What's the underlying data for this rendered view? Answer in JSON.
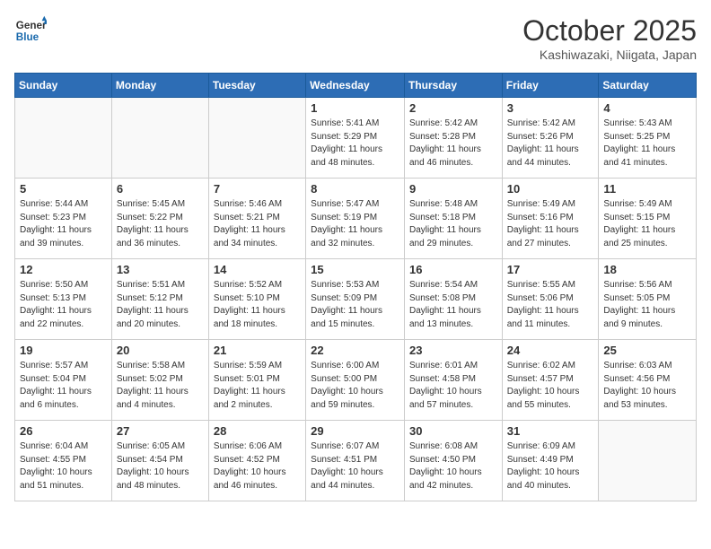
{
  "logo": {
    "line1": "General",
    "line2": "Blue"
  },
  "title": "October 2025",
  "location": "Kashiwazaki, Niigata, Japan",
  "weekdays": [
    "Sunday",
    "Monday",
    "Tuesday",
    "Wednesday",
    "Thursday",
    "Friday",
    "Saturday"
  ],
  "weeks": [
    [
      {
        "day": "",
        "sunrise": "",
        "sunset": "",
        "daylight": ""
      },
      {
        "day": "",
        "sunrise": "",
        "sunset": "",
        "daylight": ""
      },
      {
        "day": "",
        "sunrise": "",
        "sunset": "",
        "daylight": ""
      },
      {
        "day": "1",
        "sunrise": "Sunrise: 5:41 AM",
        "sunset": "Sunset: 5:29 PM",
        "daylight": "Daylight: 11 hours and 48 minutes."
      },
      {
        "day": "2",
        "sunrise": "Sunrise: 5:42 AM",
        "sunset": "Sunset: 5:28 PM",
        "daylight": "Daylight: 11 hours and 46 minutes."
      },
      {
        "day": "3",
        "sunrise": "Sunrise: 5:42 AM",
        "sunset": "Sunset: 5:26 PM",
        "daylight": "Daylight: 11 hours and 44 minutes."
      },
      {
        "day": "4",
        "sunrise": "Sunrise: 5:43 AM",
        "sunset": "Sunset: 5:25 PM",
        "daylight": "Daylight: 11 hours and 41 minutes."
      }
    ],
    [
      {
        "day": "5",
        "sunrise": "Sunrise: 5:44 AM",
        "sunset": "Sunset: 5:23 PM",
        "daylight": "Daylight: 11 hours and 39 minutes."
      },
      {
        "day": "6",
        "sunrise": "Sunrise: 5:45 AM",
        "sunset": "Sunset: 5:22 PM",
        "daylight": "Daylight: 11 hours and 36 minutes."
      },
      {
        "day": "7",
        "sunrise": "Sunrise: 5:46 AM",
        "sunset": "Sunset: 5:21 PM",
        "daylight": "Daylight: 11 hours and 34 minutes."
      },
      {
        "day": "8",
        "sunrise": "Sunrise: 5:47 AM",
        "sunset": "Sunset: 5:19 PM",
        "daylight": "Daylight: 11 hours and 32 minutes."
      },
      {
        "day": "9",
        "sunrise": "Sunrise: 5:48 AM",
        "sunset": "Sunset: 5:18 PM",
        "daylight": "Daylight: 11 hours and 29 minutes."
      },
      {
        "day": "10",
        "sunrise": "Sunrise: 5:49 AM",
        "sunset": "Sunset: 5:16 PM",
        "daylight": "Daylight: 11 hours and 27 minutes."
      },
      {
        "day": "11",
        "sunrise": "Sunrise: 5:49 AM",
        "sunset": "Sunset: 5:15 PM",
        "daylight": "Daylight: 11 hours and 25 minutes."
      }
    ],
    [
      {
        "day": "12",
        "sunrise": "Sunrise: 5:50 AM",
        "sunset": "Sunset: 5:13 PM",
        "daylight": "Daylight: 11 hours and 22 minutes."
      },
      {
        "day": "13",
        "sunrise": "Sunrise: 5:51 AM",
        "sunset": "Sunset: 5:12 PM",
        "daylight": "Daylight: 11 hours and 20 minutes."
      },
      {
        "day": "14",
        "sunrise": "Sunrise: 5:52 AM",
        "sunset": "Sunset: 5:10 PM",
        "daylight": "Daylight: 11 hours and 18 minutes."
      },
      {
        "day": "15",
        "sunrise": "Sunrise: 5:53 AM",
        "sunset": "Sunset: 5:09 PM",
        "daylight": "Daylight: 11 hours and 15 minutes."
      },
      {
        "day": "16",
        "sunrise": "Sunrise: 5:54 AM",
        "sunset": "Sunset: 5:08 PM",
        "daylight": "Daylight: 11 hours and 13 minutes."
      },
      {
        "day": "17",
        "sunrise": "Sunrise: 5:55 AM",
        "sunset": "Sunset: 5:06 PM",
        "daylight": "Daylight: 11 hours and 11 minutes."
      },
      {
        "day": "18",
        "sunrise": "Sunrise: 5:56 AM",
        "sunset": "Sunset: 5:05 PM",
        "daylight": "Daylight: 11 hours and 9 minutes."
      }
    ],
    [
      {
        "day": "19",
        "sunrise": "Sunrise: 5:57 AM",
        "sunset": "Sunset: 5:04 PM",
        "daylight": "Daylight: 11 hours and 6 minutes."
      },
      {
        "day": "20",
        "sunrise": "Sunrise: 5:58 AM",
        "sunset": "Sunset: 5:02 PM",
        "daylight": "Daylight: 11 hours and 4 minutes."
      },
      {
        "day": "21",
        "sunrise": "Sunrise: 5:59 AM",
        "sunset": "Sunset: 5:01 PM",
        "daylight": "Daylight: 11 hours and 2 minutes."
      },
      {
        "day": "22",
        "sunrise": "Sunrise: 6:00 AM",
        "sunset": "Sunset: 5:00 PM",
        "daylight": "Daylight: 10 hours and 59 minutes."
      },
      {
        "day": "23",
        "sunrise": "Sunrise: 6:01 AM",
        "sunset": "Sunset: 4:58 PM",
        "daylight": "Daylight: 10 hours and 57 minutes."
      },
      {
        "day": "24",
        "sunrise": "Sunrise: 6:02 AM",
        "sunset": "Sunset: 4:57 PM",
        "daylight": "Daylight: 10 hours and 55 minutes."
      },
      {
        "day": "25",
        "sunrise": "Sunrise: 6:03 AM",
        "sunset": "Sunset: 4:56 PM",
        "daylight": "Daylight: 10 hours and 53 minutes."
      }
    ],
    [
      {
        "day": "26",
        "sunrise": "Sunrise: 6:04 AM",
        "sunset": "Sunset: 4:55 PM",
        "daylight": "Daylight: 10 hours and 51 minutes."
      },
      {
        "day": "27",
        "sunrise": "Sunrise: 6:05 AM",
        "sunset": "Sunset: 4:54 PM",
        "daylight": "Daylight: 10 hours and 48 minutes."
      },
      {
        "day": "28",
        "sunrise": "Sunrise: 6:06 AM",
        "sunset": "Sunset: 4:52 PM",
        "daylight": "Daylight: 10 hours and 46 minutes."
      },
      {
        "day": "29",
        "sunrise": "Sunrise: 6:07 AM",
        "sunset": "Sunset: 4:51 PM",
        "daylight": "Daylight: 10 hours and 44 minutes."
      },
      {
        "day": "30",
        "sunrise": "Sunrise: 6:08 AM",
        "sunset": "Sunset: 4:50 PM",
        "daylight": "Daylight: 10 hours and 42 minutes."
      },
      {
        "day": "31",
        "sunrise": "Sunrise: 6:09 AM",
        "sunset": "Sunset: 4:49 PM",
        "daylight": "Daylight: 10 hours and 40 minutes."
      },
      {
        "day": "",
        "sunrise": "",
        "sunset": "",
        "daylight": ""
      }
    ]
  ]
}
